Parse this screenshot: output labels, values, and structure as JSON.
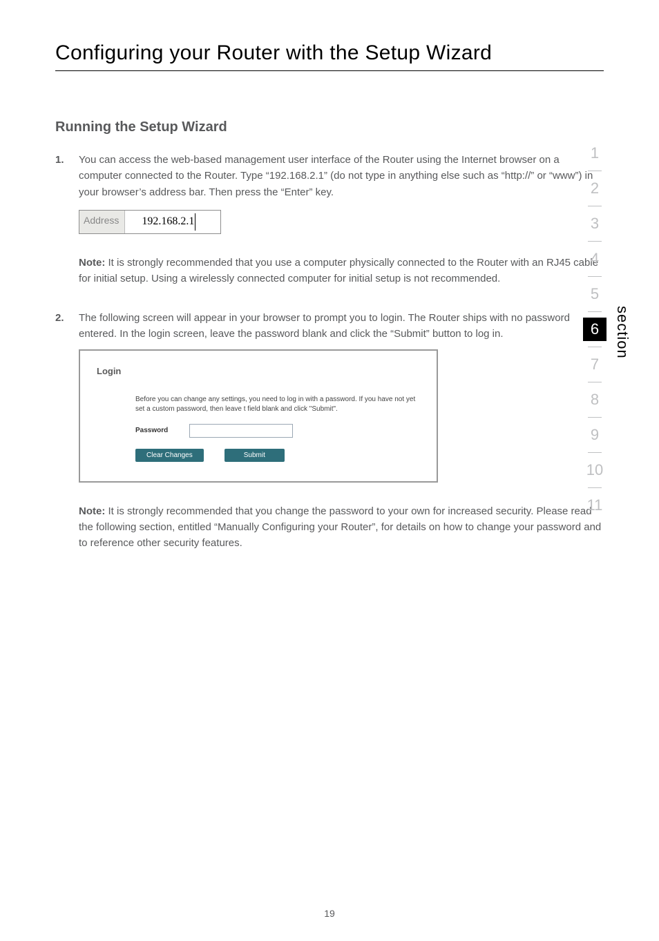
{
  "page": {
    "title": "Configuring your Router with the Setup Wizard",
    "subtitle": "Running the Setup Wizard",
    "number": "19"
  },
  "steps": {
    "step1": {
      "num": "1.",
      "text": "You can access the web-based management user interface of the Router using the Internet browser on a computer connected to the Router. Type “192.168.2.1” (do not type in anything else such as “http://” or “www”) in your browser’s address bar. Then press the “Enter” key.",
      "note_label": "Note:",
      "note": " It is strongly recommended that you use a computer physically connected to the Router with an RJ45 cable for initial setup. Using a wirelessly connected computer for initial setup is not recommended."
    },
    "step2": {
      "num": "2.",
      "text": "The following screen will appear in your browser to prompt you to login. The Router ships with no password entered. In the login screen, leave the password blank and click the “Submit” button to log in.",
      "note_label": "Note:",
      "note": " It is strongly recommended that you change the password to your own for increased security. Please read the following section, entitled “Manually Configuring your Router”, for details on how to change your password and to reference other security features."
    }
  },
  "address_bar": {
    "label": "Address",
    "value": "192.168.2.1"
  },
  "login": {
    "title": "Login",
    "text": "Before you can change any settings, you need to log in with a password. If you have not yet set a custom password, then leave t field blank and click \"Submit\".",
    "password_label": "Password",
    "clear_btn": "Clear Changes",
    "submit_btn": "Submit"
  },
  "section_nav": {
    "label": "section",
    "items": [
      "1",
      "2",
      "3",
      "4",
      "5",
      "6",
      "7",
      "8",
      "9",
      "10",
      "11"
    ],
    "current": "6"
  }
}
